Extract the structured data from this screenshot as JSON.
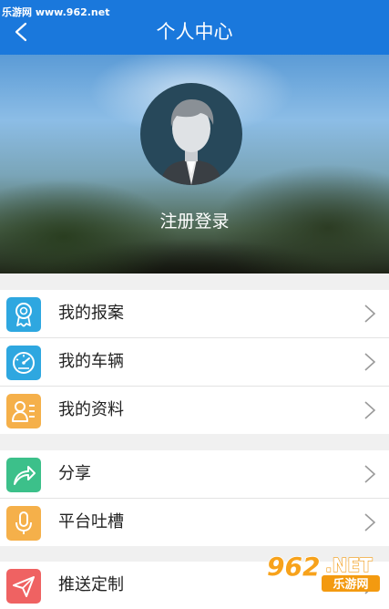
{
  "status_bar": {
    "watermark": "乐游网 www.962.net"
  },
  "header": {
    "title": "个人中心",
    "back_icon": "chevron-left-icon"
  },
  "profile": {
    "login_label": "注册登录",
    "avatar_icon": "default-avatar-icon"
  },
  "menu_groups": [
    [
      {
        "label": "我的报案",
        "icon": "award-badge-icon",
        "color": "#2ea7e0"
      },
      {
        "label": "我的车辆",
        "icon": "speedometer-icon",
        "color": "#2ea7e0"
      },
      {
        "label": "我的资料",
        "icon": "profile-card-icon",
        "color": "#f5b04a"
      }
    ],
    [
      {
        "label": "分享",
        "icon": "share-arrow-icon",
        "color": "#3cc08a"
      },
      {
        "label": "平台吐槽",
        "icon": "microphone-icon",
        "color": "#f5b04a"
      }
    ],
    [
      {
        "label": "推送定制",
        "icon": "paper-plane-icon",
        "color": "#ef6262"
      }
    ]
  ],
  "colors": {
    "primary": "#1a78dc",
    "background": "#f0f0f0",
    "text": "#222222",
    "chevron": "#9a9a9a"
  },
  "watermark_logo": {
    "number": "962",
    "suffix": ".NET",
    "caption": "乐游网"
  }
}
